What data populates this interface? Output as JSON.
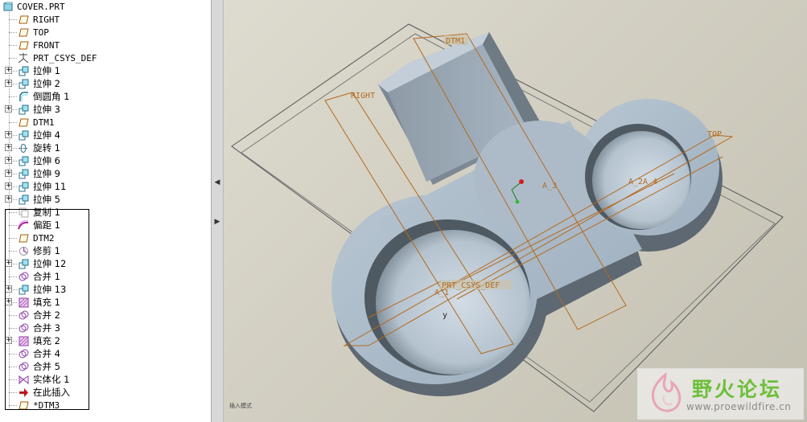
{
  "model_tree": {
    "root": "COVER.PRT",
    "items": [
      {
        "label": "RIGHT",
        "icon": "datum-plane-icon",
        "expandable": false
      },
      {
        "label": "TOP",
        "icon": "datum-plane-icon",
        "expandable": false
      },
      {
        "label": "FRONT",
        "icon": "datum-plane-icon",
        "expandable": false
      },
      {
        "label": "PRT_CSYS_DEF",
        "icon": "csys-icon",
        "expandable": false
      },
      {
        "label": "拉伸 1",
        "icon": "extrude-icon",
        "expandable": true
      },
      {
        "label": "拉伸 2",
        "icon": "extrude-icon",
        "expandable": true
      },
      {
        "label": "倒圆角 1",
        "icon": "round-icon",
        "expandable": false
      },
      {
        "label": "拉伸 3",
        "icon": "extrude-icon",
        "expandable": true
      },
      {
        "label": "DTM1",
        "icon": "datum-plane-icon",
        "expandable": false
      },
      {
        "label": "拉伸 4",
        "icon": "extrude-icon",
        "expandable": true
      },
      {
        "label": "旋转 1",
        "icon": "revolve-icon",
        "expandable": true
      },
      {
        "label": "拉伸 6",
        "icon": "extrude-icon",
        "expandable": true
      },
      {
        "label": "拉伸 9",
        "icon": "extrude-icon",
        "expandable": true
      },
      {
        "label": "拉伸 11",
        "icon": "extrude-icon",
        "expandable": true
      },
      {
        "label": "拉伸 5",
        "icon": "extrude-icon",
        "expandable": true
      },
      {
        "label": "复制 1",
        "icon": "copy-icon",
        "expandable": false
      },
      {
        "label": "偏距 1",
        "icon": "offset-icon",
        "expandable": false
      },
      {
        "label": "DTM2",
        "icon": "datum-plane-icon",
        "expandable": false
      },
      {
        "label": "修剪 1",
        "icon": "trim-icon",
        "expandable": false
      },
      {
        "label": "拉伸 12",
        "icon": "extrude-icon",
        "expandable": true
      },
      {
        "label": "合并 1",
        "icon": "merge-icon",
        "expandable": false
      },
      {
        "label": "拉伸 13",
        "icon": "extrude-icon",
        "expandable": true
      },
      {
        "label": "填充 1",
        "icon": "fill-icon",
        "expandable": true
      },
      {
        "label": "合并 2",
        "icon": "merge-icon",
        "expandable": false
      },
      {
        "label": "合并 3",
        "icon": "merge-icon",
        "expandable": false
      },
      {
        "label": "填充 2",
        "icon": "fill-icon",
        "expandable": true
      },
      {
        "label": "合并 4",
        "icon": "merge-icon",
        "expandable": false
      },
      {
        "label": "合并 5",
        "icon": "merge-icon",
        "expandable": false
      },
      {
        "label": "实体化 1",
        "icon": "solidify-icon",
        "expandable": false
      },
      {
        "label": "在此插入",
        "icon": "insert-here-arrow-icon",
        "expandable": false
      },
      {
        "label": "*DTM3",
        "icon": "datum-plane-icon",
        "expandable": false
      }
    ]
  },
  "viewport": {
    "datum_labels": {
      "dtm1": "DTM1",
      "right": "RIGHT",
      "top": "TOP",
      "a3": "A_3",
      "a2a4": "A_2A_4",
      "csys": "PRT_CSYS_DEF",
      "a1": "A_1",
      "y": "y"
    },
    "status_text": "插入模式"
  },
  "watermark": {
    "title": "野火论坛",
    "url": "www.proewildfire.cn"
  },
  "colors": {
    "datum_orange": "#b46a1e",
    "part_gray": "#a8b6c3",
    "part_dark": "#5f6b76",
    "watermark_green": "#6cbf3a"
  }
}
